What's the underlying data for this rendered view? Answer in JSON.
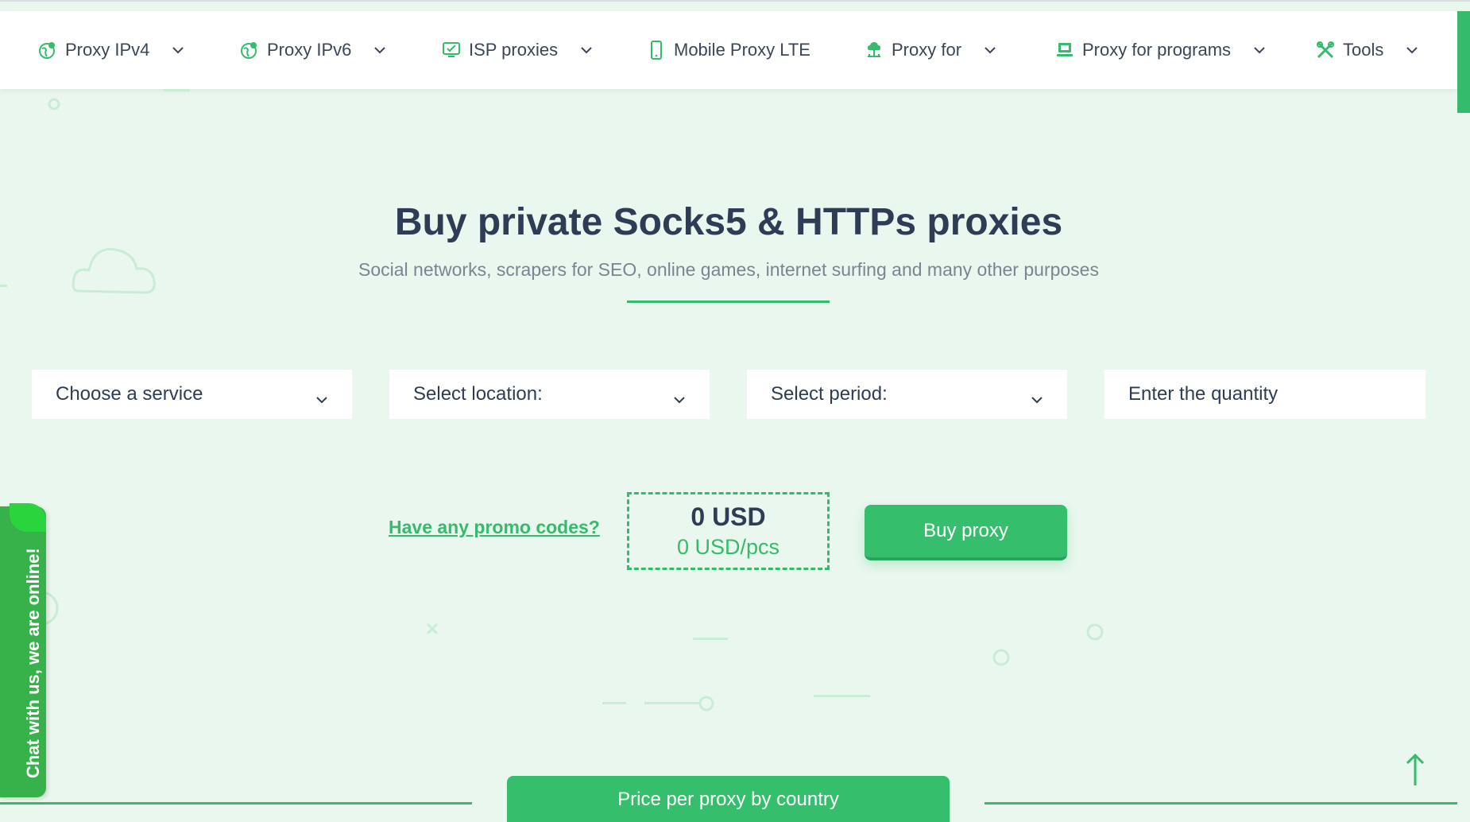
{
  "nav": {
    "items": [
      {
        "label": "Proxy IPv4",
        "icon": "globe-pin-icon",
        "has_dropdown": true
      },
      {
        "label": "Proxy IPv6",
        "icon": "globe-pin-icon",
        "has_dropdown": true
      },
      {
        "label": "ISP proxies",
        "icon": "monitor-check-icon",
        "has_dropdown": true
      },
      {
        "label": "Mobile Proxy LTE",
        "icon": "smartphone-icon",
        "has_dropdown": false
      },
      {
        "label": "Proxy for",
        "icon": "cloud-network-icon",
        "has_dropdown": true
      },
      {
        "label": "Proxy for programs",
        "icon": "laptop-icon",
        "has_dropdown": true
      },
      {
        "label": "Tools",
        "icon": "tools-icon",
        "has_dropdown": true
      }
    ]
  },
  "hero": {
    "title": "Buy private Socks5 & HTTPs proxies",
    "subtitle": "Social networks, scrapers for SEO, online games, internet surfing and many other purposes"
  },
  "order_form": {
    "service_select": "Choose a service",
    "location_select": "Select location:",
    "period_select": "Select period:",
    "quantity_placeholder": "Enter the quantity",
    "promo_link": "Have any promo codes?",
    "total_price": "0 USD",
    "unit_price": "0 USD/pcs",
    "buy_button": "Buy proxy"
  },
  "chat": {
    "label": "Chat with us, we are online!"
  },
  "bottom": {
    "price_by_country_button": "Price per proxy by country"
  },
  "colors": {
    "accent": "#35bf6d",
    "background": "#eaf7ee",
    "heading": "#2e3d55",
    "chat": "#37b14a"
  }
}
